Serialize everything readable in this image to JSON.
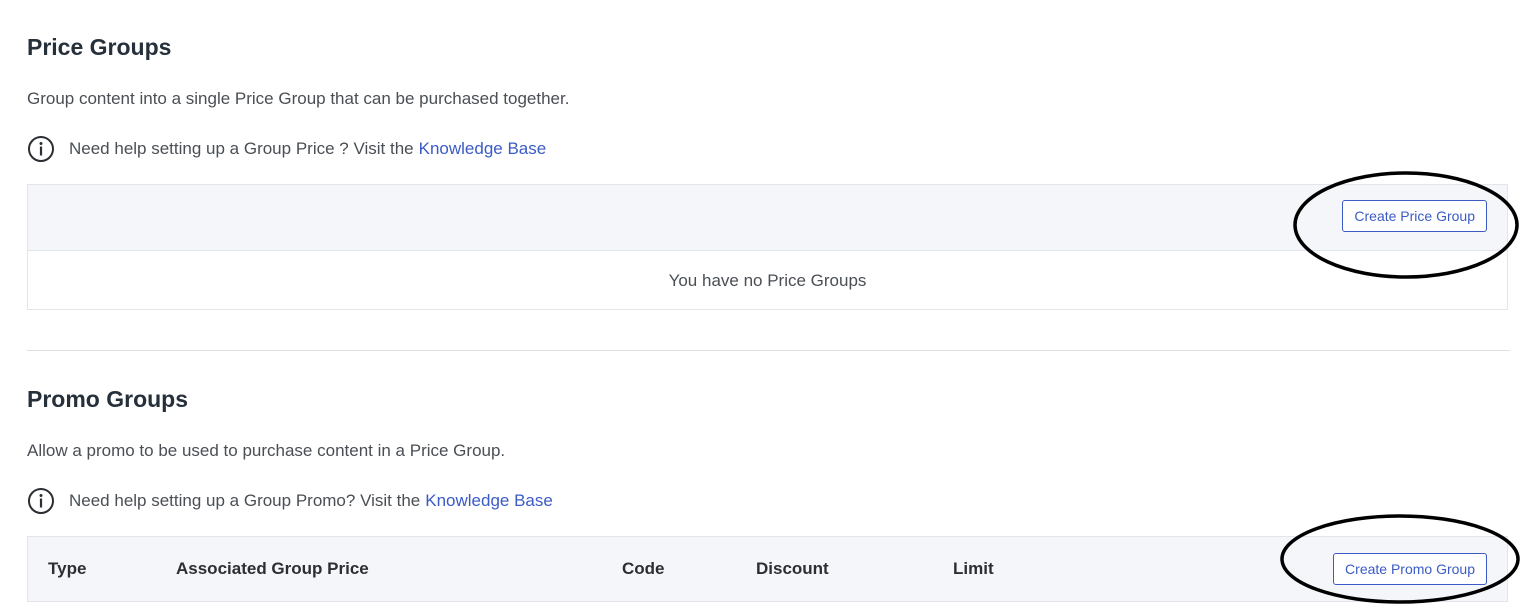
{
  "price_groups": {
    "title": "Price Groups",
    "description": "Group content into a single Price Group that can be purchased together.",
    "help_text": "Need help setting up a Group Price ? Visit the",
    "help_link": "Knowledge Base",
    "create_button": "Create Price Group",
    "empty_message": "You have no Price Groups"
  },
  "promo_groups": {
    "title": "Promo Groups",
    "description": "Allow a promo to be used to purchase content in a Price Group.",
    "help_text": "Need help setting up a Group Promo? Visit the",
    "help_link": "Knowledge Base",
    "create_button": "Create Promo Group",
    "columns": [
      "Type",
      "Associated Group Price",
      "Code",
      "Discount",
      "Limit"
    ]
  },
  "icons": {
    "info": "info-circle-icon"
  },
  "colors": {
    "accent": "#3b5bc5",
    "header_bg": "#f5f6fa",
    "annotation": "#000000"
  }
}
